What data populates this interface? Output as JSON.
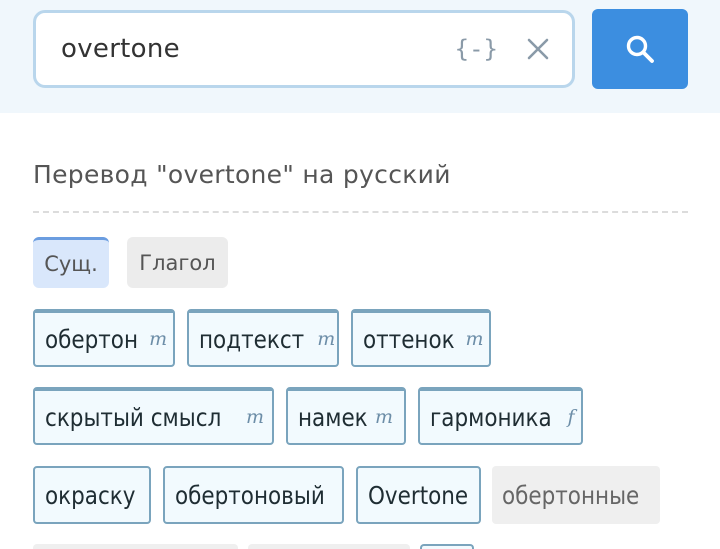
{
  "search": {
    "query": "overtone",
    "regex_icon_text": "{-}",
    "icons": {
      "clear": "close-icon",
      "submit": "search-icon"
    },
    "button_color": "#3c8ee0"
  },
  "heading": "Перевод \"overtone\" на русский",
  "pos_tabs": [
    {
      "label": "Сущ.",
      "active": true
    },
    {
      "label": "Глагол",
      "active": false
    }
  ],
  "translations": [
    {
      "word": "обертон",
      "gender": "m"
    },
    {
      "word": "подтекст",
      "gender": "m"
    },
    {
      "word": "оттенок",
      "gender": "m"
    },
    {
      "word": "скрытый смысл",
      "gender": "m"
    },
    {
      "word": "намек",
      "gender": "m"
    },
    {
      "word": "гармоника",
      "gender": "f"
    },
    {
      "word": "окраску",
      "gender": ""
    },
    {
      "word": "обертоновый",
      "gender": ""
    },
    {
      "word": "Overtone",
      "gender": ""
    },
    {
      "word": "обертонные",
      "gender": ""
    }
  ]
}
